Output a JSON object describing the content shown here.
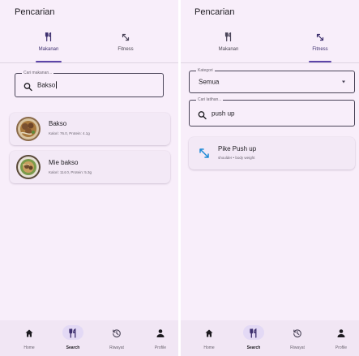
{
  "screens": [
    {
      "title": "Pencarian",
      "tabs": [
        {
          "label": "Makanan",
          "icon": "fork-knife-icon",
          "active": true
        },
        {
          "label": "Fitness",
          "icon": "fitness-arrows-icon",
          "active": false
        }
      ],
      "search": {
        "label": "Cari makanan...",
        "value": "Bakso"
      },
      "results": [
        {
          "title": "Bakso",
          "subtitle": "Kalori: 76.0, Protein: 4.1g"
        },
        {
          "title": "Mie bakso",
          "subtitle": "Kalori: 114.0, Protein: 5.3g"
        }
      ]
    },
    {
      "title": "Pencarian",
      "tabs": [
        {
          "label": "Makanan",
          "icon": "fork-knife-icon",
          "active": false
        },
        {
          "label": "Fitness",
          "icon": "fitness-arrows-icon",
          "active": true
        }
      ],
      "category": {
        "label": "Kategori",
        "value": "Semua"
      },
      "search": {
        "label": "Cari latihan...",
        "value": "push up"
      },
      "results": [
        {
          "title": "Pike Push up",
          "subtitle": "shoulder • body weight"
        }
      ]
    }
  ],
  "bottom_nav": [
    {
      "label": "Home",
      "icon": "home-icon",
      "active": false
    },
    {
      "label": "Search",
      "icon": "fork-knife-icon",
      "active": true
    },
    {
      "label": "Riwayat",
      "icon": "history-icon",
      "active": false
    },
    {
      "label": "Profile",
      "icon": "person-icon",
      "active": false
    }
  ],
  "colors": {
    "background": "#f8eefa",
    "accent": "#5d45a8",
    "active_pill": "#e3d9f5",
    "card": "#f3e9f6"
  }
}
